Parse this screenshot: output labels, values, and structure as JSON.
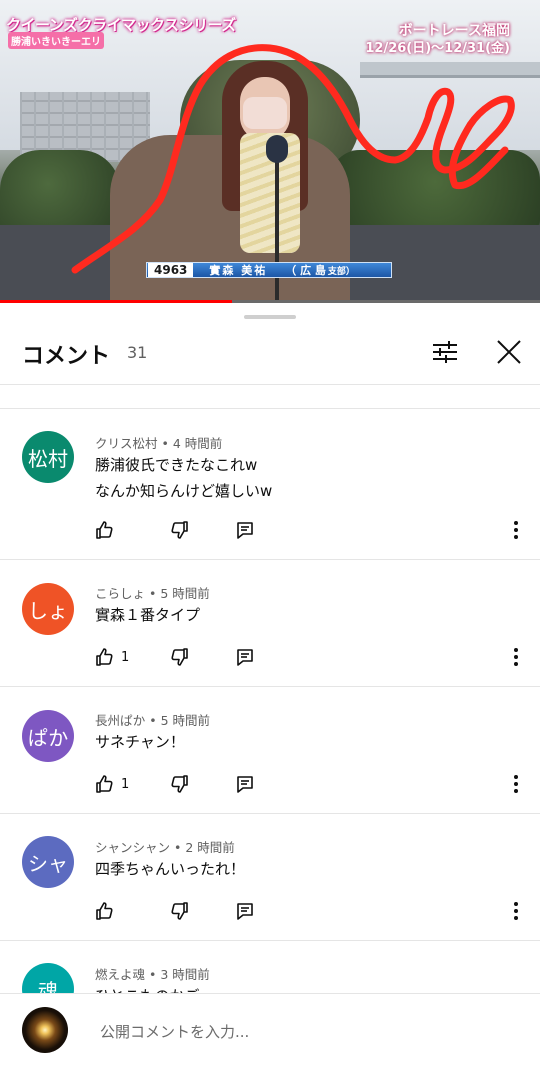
{
  "video": {
    "overlay_title": "クイーンズクライマックスシリーズ",
    "overlay_subtitle": "勝浦いきいきーエリ",
    "venue": "ボートレース福岡",
    "dates": "12/26(日)〜12/31(金)",
    "racer_number": "4963",
    "racer_name": "實森 美祐",
    "racer_branch": "（ 広 島",
    "racer_branch_suffix": "支部）",
    "progress": 0.43,
    "scribble_color": "#ff2a1f"
  },
  "comments_panel": {
    "title": "コメント",
    "count": "31",
    "filter_icon": "sliders-icon",
    "close_icon": "close-icon"
  },
  "comments": [
    {
      "avatar_text": "松村",
      "avatar_color": "#0a8a6e",
      "author": "クリス松村",
      "time": "4 時間前",
      "text": "勝浦彼氏できたなこれw\nなんか知らんけど嬉しいw",
      "likes": ""
    },
    {
      "avatar_text": "しょ",
      "avatar_color": "#ef5326",
      "author": "こらしょ",
      "time": "5 時間前",
      "text": "實森１番タイプ",
      "likes": "1"
    },
    {
      "avatar_text": "ぱか",
      "avatar_color": "#7e57c2",
      "author": "長州ぱか",
      "time": "5 時間前",
      "text": "サネチャン！",
      "likes": "1"
    },
    {
      "avatar_text": "シャ",
      "avatar_color": "#5c6bc0",
      "author": "シャンシャン",
      "time": "2 時間前",
      "text": "四季ちゃんいったれ！",
      "likes": ""
    },
    {
      "avatar_text": "魂",
      "avatar_color": "#00a6a6",
      "author": "燃えよ魂",
      "time": "3 時間前",
      "text": "ひとこものかご",
      "likes": ""
    }
  ],
  "input": {
    "placeholder": "公開コメントを入力..."
  }
}
